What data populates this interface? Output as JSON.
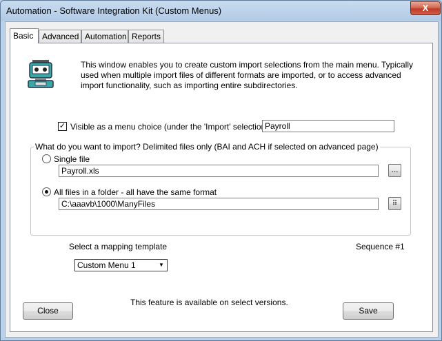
{
  "window": {
    "title": "Automation - Software Integration Kit (Custom Menus)",
    "close_glyph": "X"
  },
  "tabs": [
    {
      "label": "Basic",
      "active": true
    },
    {
      "label": "Advanced",
      "active": false
    },
    {
      "label": "Automation",
      "active": false
    },
    {
      "label": "Reports",
      "active": false
    }
  ],
  "basic": {
    "description": "This window enables you to create custom import selections from the main menu.  Typically used when multiple import files of different formats are imported, or to access advanced import functionality, such as importing entire subdirectories.",
    "visible_checkbox": {
      "label": "Visible as a menu choice (under the 'Import' selection) as:",
      "checked": true,
      "check_glyph": "✓"
    },
    "menu_name": "Payroll",
    "import_group": {
      "label": "What do you want to import?  Delimited files only (BAI and ACH if selected on advanced page)",
      "single_file": {
        "label": "Single file",
        "selected": false,
        "value": "Payroll.xls",
        "browse_label": "..."
      },
      "folder": {
        "label": "All files in a folder - all have the same format",
        "selected": true,
        "value": "C:\\aaavb\\1000\\ManyFiles",
        "browse_label": "⠿"
      }
    },
    "mapping_label": "Select a mapping template",
    "sequence_label": "Sequence #1",
    "mapping_selected": "Custom Menu 1",
    "notice": "This feature is available on select versions."
  },
  "buttons": {
    "close": "Close",
    "save": "Save"
  },
  "colors": {
    "title_bar": "#b9d1ea",
    "close_button": "#c0392b",
    "robot_teal": "#3aa8a8"
  }
}
